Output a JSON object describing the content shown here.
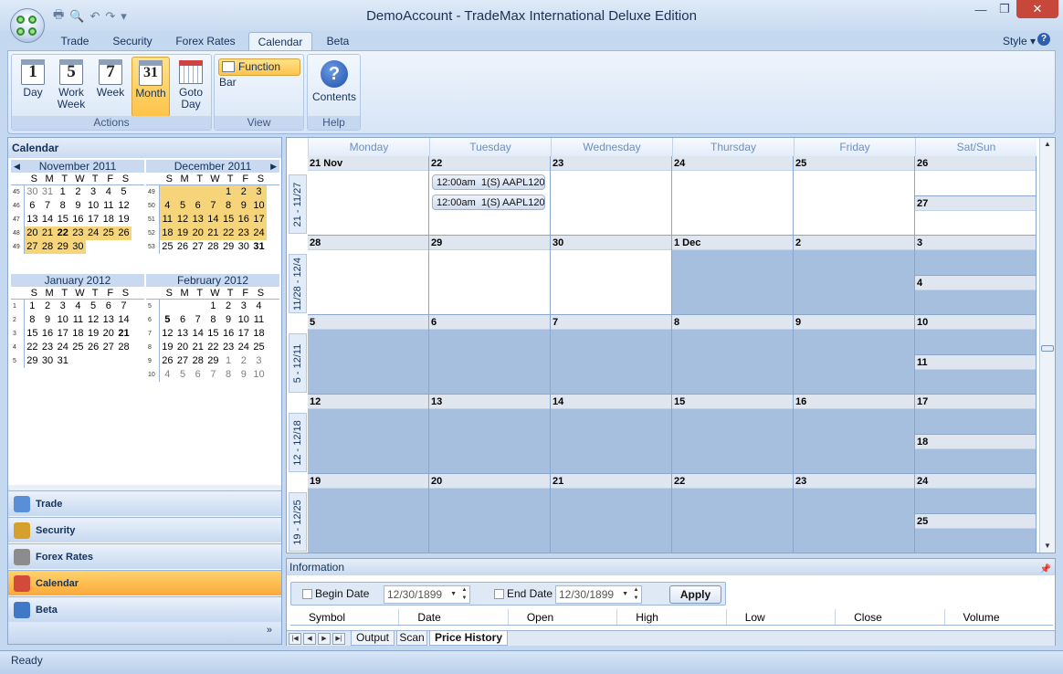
{
  "window": {
    "title": "DemoAccount - TradeMax International Deluxe Edition"
  },
  "ribbon": {
    "tabs": [
      "Trade",
      "Security",
      "Forex Rates",
      "Calendar",
      "Beta"
    ],
    "active_tab": "Calendar",
    "style_label": "Style",
    "actions_group": {
      "label": "Actions",
      "buttons": [
        {
          "icon": "1",
          "label": "Day"
        },
        {
          "icon": "5",
          "label": "Work Week"
        },
        {
          "icon": "7",
          "label": "Week"
        },
        {
          "icon": "31",
          "label": "Month"
        },
        {
          "icon": "grid",
          "label": "Goto Day"
        }
      ]
    },
    "view_group": {
      "label": "View",
      "function_bar": "Function Bar"
    },
    "help_group": {
      "label": "Help",
      "contents": "Contents"
    }
  },
  "left": {
    "calendar_title": "Calendar",
    "dow": [
      "S",
      "M",
      "T",
      "W",
      "T",
      "F",
      "S"
    ],
    "months": [
      {
        "name": "November 2011",
        "weeks": [
          {
            "wn": "45",
            "days": [
              "30",
              "31",
              "1",
              "2",
              "3",
              "4",
              "5"
            ],
            "other": [
              0,
              1
            ]
          },
          {
            "wn": "46",
            "days": [
              "6",
              "7",
              "8",
              "9",
              "10",
              "11",
              "12"
            ]
          },
          {
            "wn": "47",
            "days": [
              "13",
              "14",
              "15",
              "16",
              "17",
              "18",
              "19"
            ]
          },
          {
            "wn": "48",
            "days": [
              "20",
              "21",
              "22",
              "23",
              "24",
              "25",
              "26"
            ],
            "hl": [
              0,
              1,
              2,
              3,
              4,
              5,
              6
            ],
            "bold": [
              2
            ]
          },
          {
            "wn": "49",
            "days": [
              "27",
              "28",
              "29",
              "30",
              "",
              "",
              ""
            ],
            "hl": [
              0,
              1,
              2,
              3
            ]
          }
        ]
      },
      {
        "name": "December 2011",
        "weeks": [
          {
            "wn": "49",
            "days": [
              "",
              "",
              "",
              "",
              "1",
              "2",
              "3"
            ],
            "hl": [
              0,
              1,
              2,
              3,
              4,
              5,
              6
            ]
          },
          {
            "wn": "50",
            "days": [
              "4",
              "5",
              "6",
              "7",
              "8",
              "9",
              "10"
            ],
            "hl": [
              0,
              1,
              2,
              3,
              4,
              5,
              6
            ]
          },
          {
            "wn": "51",
            "days": [
              "11",
              "12",
              "13",
              "14",
              "15",
              "16",
              "17"
            ],
            "hl": [
              0,
              1,
              2,
              3,
              4,
              5,
              6
            ]
          },
          {
            "wn": "52",
            "days": [
              "18",
              "19",
              "20",
              "21",
              "22",
              "23",
              "24"
            ],
            "hl": [
              0,
              1,
              2,
              3,
              4,
              5,
              6
            ]
          },
          {
            "wn": "53",
            "days": [
              "25",
              "26",
              "27",
              "28",
              "29",
              "30",
              "31"
            ],
            "bold": [
              6
            ]
          }
        ]
      },
      {
        "name": "January 2012",
        "weeks": [
          {
            "wn": "1",
            "days": [
              "1",
              "2",
              "3",
              "4",
              "5",
              "6",
              "7"
            ]
          },
          {
            "wn": "2",
            "days": [
              "8",
              "9",
              "10",
              "11",
              "12",
              "13",
              "14"
            ]
          },
          {
            "wn": "3",
            "days": [
              "15",
              "16",
              "17",
              "18",
              "19",
              "20",
              "21"
            ],
            "bold": [
              6
            ]
          },
          {
            "wn": "4",
            "days": [
              "22",
              "23",
              "24",
              "25",
              "26",
              "27",
              "28"
            ]
          },
          {
            "wn": "5",
            "days": [
              "29",
              "30",
              "31",
              "",
              "",
              "",
              ""
            ]
          }
        ]
      },
      {
        "name": "February 2012",
        "weeks": [
          {
            "wn": "5",
            "days": [
              "",
              "",
              "",
              "1",
              "2",
              "3",
              "4"
            ]
          },
          {
            "wn": "6",
            "days": [
              "5",
              "6",
              "7",
              "8",
              "9",
              "10",
              "11"
            ],
            "bold": [
              0
            ]
          },
          {
            "wn": "7",
            "days": [
              "12",
              "13",
              "14",
              "15",
              "16",
              "17",
              "18"
            ]
          },
          {
            "wn": "8",
            "days": [
              "19",
              "20",
              "21",
              "22",
              "23",
              "24",
              "25"
            ]
          },
          {
            "wn": "9",
            "days": [
              "26",
              "27",
              "28",
              "29",
              "1",
              "2",
              "3"
            ],
            "other": [
              4,
              5,
              6
            ]
          },
          {
            "wn": "10",
            "days": [
              "4",
              "5",
              "6",
              "7",
              "8",
              "9",
              "10"
            ],
            "other": [
              0,
              1,
              2,
              3,
              4,
              5,
              6
            ]
          }
        ]
      }
    ],
    "nav": [
      {
        "label": "Trade",
        "icon": "house-icon"
      },
      {
        "label": "Security",
        "icon": "chart-icon"
      },
      {
        "label": "Forex Rates",
        "icon": "dice-icon"
      },
      {
        "label": "Calendar",
        "icon": "checklist-icon",
        "active": true
      },
      {
        "label": "Beta",
        "icon": "table-icon"
      }
    ],
    "more": "»"
  },
  "calendar": {
    "days": [
      "Monday",
      "Tuesday",
      "Wednesday",
      "Thursday",
      "Friday",
      "Sat/Sun"
    ],
    "weeks": [
      {
        "label": "21 - 11/27",
        "dates": [
          "21 Nov",
          "22",
          "23",
          "24",
          "25"
        ],
        "sat": "26",
        "sun": "27",
        "gray": []
      },
      {
        "label": "11/28 - 12/4",
        "dates": [
          "28",
          "29",
          "30",
          "1 Dec",
          "2"
        ],
        "sat": "3",
        "sun": "4",
        "gray": [
          3,
          4,
          5
        ]
      },
      {
        "label": "5 - 12/11",
        "dates": [
          "5",
          "6",
          "7",
          "8",
          "9"
        ],
        "sat": "10",
        "sun": "11",
        "gray": [
          0,
          1,
          2,
          3,
          4,
          5
        ]
      },
      {
        "label": "12 - 12/18",
        "dates": [
          "12",
          "13",
          "14",
          "15",
          "16"
        ],
        "sat": "17",
        "sun": "18",
        "gray": [
          0,
          1,
          2,
          3,
          4,
          5
        ]
      },
      {
        "label": "19 - 12/25",
        "dates": [
          "19",
          "20",
          "21",
          "22",
          "23"
        ],
        "sat": "24",
        "sun": "25",
        "gray": [
          0,
          1,
          2,
          3,
          4,
          5
        ]
      }
    ],
    "appointments": [
      {
        "week": 0,
        "day": 1,
        "time": "12:00am",
        "text": "1(S) AAPL120"
      },
      {
        "week": 0,
        "day": 1,
        "time": "12:00am",
        "text": "1(S) AAPL120"
      }
    ]
  },
  "info": {
    "title": "Information",
    "begin_label": "Begin Date",
    "begin_value": "12/30/1899",
    "end_label": "End Date",
    "end_value": "12/30/1899",
    "apply": "Apply",
    "columns": [
      "Symbol",
      "Date",
      "Open",
      "High",
      "Low",
      "Close",
      "Volume"
    ],
    "tabs": [
      "Output",
      "Scan",
      "Price History"
    ],
    "active_tab": "Price History"
  },
  "status": "Ready"
}
